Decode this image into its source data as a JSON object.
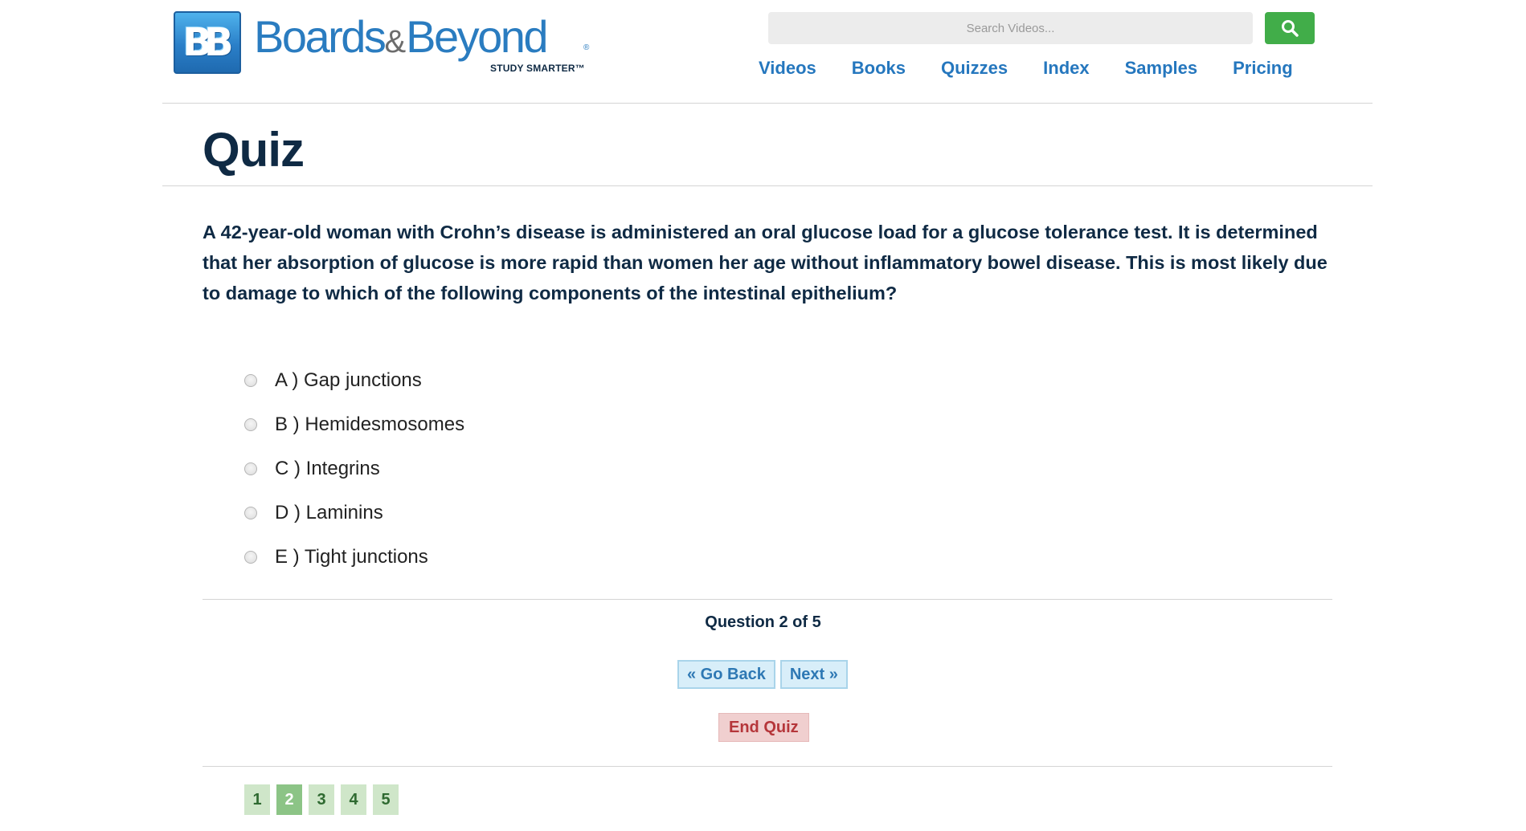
{
  "header": {
    "logo_mark": "BB",
    "logo_name_part1": "Boards",
    "logo_amp": "&",
    "logo_name_part2": "Beyond",
    "logo_reg": "®",
    "logo_tagline": "STUDY SMARTER™",
    "search_placeholder": "Search Videos...",
    "search_icon": "search-icon",
    "nav": [
      "Videos",
      "Books",
      "Quizzes",
      "Index",
      "Samples",
      "Pricing"
    ]
  },
  "page": {
    "title": "Quiz"
  },
  "quiz": {
    "question": "A 42-year-old woman with Crohn’s disease is administered an oral glucose load for a glucose tolerance test. It is determined that her absorption of glucose is more rapid than women her age without inflammatory bowel disease. This is most likely due to damage to which of the following components of the intestinal epithelium?",
    "options": [
      "A ) Gap junctions",
      "B ) Hemidesmosomes",
      "C ) Integrins",
      "D ) Laminins",
      "E ) Tight junctions"
    ],
    "progress_text": "Question 2 of 5",
    "back_label": "« Go Back",
    "next_label": "Next »",
    "end_label": "End Quiz",
    "pages": [
      "1",
      "2",
      "3",
      "4",
      "5"
    ],
    "current_page": "2"
  },
  "colors": {
    "brand_blue": "#2577be",
    "search_green": "#41ad49",
    "title_navy": "#0f2a44",
    "end_red": "#b5363a",
    "page_green": "#8cc486"
  }
}
